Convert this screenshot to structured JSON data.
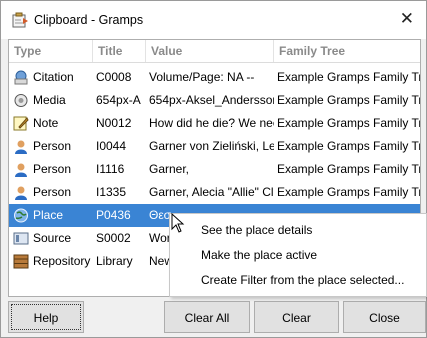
{
  "window": {
    "title": "Clipboard - Gramps",
    "close_glyph": "✕"
  },
  "columns": {
    "type": "Type",
    "title": "Title",
    "value": "Value",
    "tree": "Family Tree"
  },
  "rows": [
    {
      "type": "Citation",
      "icon": "citation-icon",
      "title": "C0008",
      "value": "Volume/Page: NA --",
      "tree": "Example Gramps Family Tree"
    },
    {
      "type": "Media",
      "icon": "media-icon",
      "title": "654px-A",
      "value": "654px-Aksel_Andersson",
      "tree": "Example Gramps Family Tree"
    },
    {
      "type": "Note",
      "icon": "note-icon",
      "title": "N0012",
      "value": "How did he die? We nee",
      "tree": "Example Gramps Family Tree"
    },
    {
      "type": "Person",
      "icon": "person-icon",
      "title": "I0044",
      "value": "Garner von Zieliński, Le",
      "tree": "Example Gramps Family Tree"
    },
    {
      "type": "Person",
      "icon": "person-icon",
      "title": "I1116",
      "value": "Garner,",
      "tree": "Example Gramps Family Tree"
    },
    {
      "type": "Person",
      "icon": "person-icon",
      "title": "I1335",
      "value": "Garner, Alecia \"Allie\" Cl",
      "tree": "Example Gramps Family Tree"
    },
    {
      "type": "Place",
      "icon": "place-icon",
      "title": "P0436",
      "value": "Θεσ",
      "tree": ""
    },
    {
      "type": "Source",
      "icon": "source-icon",
      "title": "S0002",
      "value": "Wor",
      "tree": ""
    },
    {
      "type": "Repository",
      "icon": "repository-icon",
      "title": "Library",
      "value": "New",
      "tree": ""
    }
  ],
  "context_menu": {
    "items": [
      "See the place details",
      "Make the place active",
      "Create Filter from the place selected..."
    ]
  },
  "buttons": {
    "help": "Help",
    "clear_all": "Clear All",
    "clear": "Clear",
    "close": "Close"
  },
  "colors": {
    "selection": "#3a84d4",
    "header_text": "#8a8a8a",
    "button_face": "#e1e1e1"
  }
}
